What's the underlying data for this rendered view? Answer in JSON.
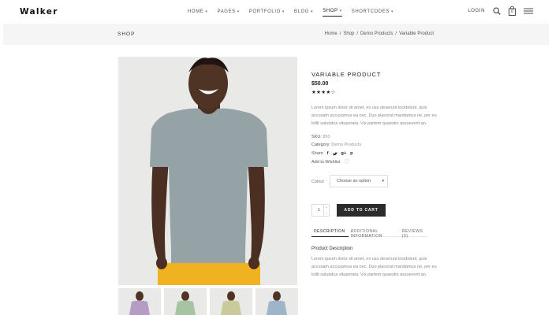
{
  "brand": {
    "logo": "Walker"
  },
  "nav": {
    "items": [
      {
        "label": "HOME",
        "active": false
      },
      {
        "label": "PAGES",
        "active": false
      },
      {
        "label": "PORTFOLIO",
        "active": false
      },
      {
        "label": "BLOG",
        "active": false
      },
      {
        "label": "SHOP",
        "active": true
      },
      {
        "label": "SHORTCODES",
        "active": false
      }
    ],
    "login": "LOGIN",
    "cart_count": "0",
    "icons": [
      "search-icon",
      "bag-icon",
      "menu-icon"
    ]
  },
  "title_band": {
    "title": "SHOP",
    "breadcrumbs": [
      "Home",
      "Shop",
      "Demo Products",
      "Variable Product"
    ],
    "separator": "/"
  },
  "product": {
    "title": "VARIABLE PRODUCT",
    "price": "$50.00",
    "rating": 4,
    "rating_max": 5,
    "short_description": "Lorem ipsum dolor sit amet, ex usu deserunt incididunt, quis accusam accusamus ea nec. Duo placerat mandamus ne, per eu tollit salutatus vituperata. Vix partem quaestio assueverit an.",
    "sku_label": "SKU:",
    "sku_value": "850",
    "category_label": "Category:",
    "category_value": "Demo Products",
    "share_label": "Share",
    "share_icons": [
      "facebook-icon",
      "twitter-icon",
      "google-plus-icon",
      "pinterest-icon"
    ],
    "wishlist_label": "Add to Wishlist",
    "variation_label": "Colour",
    "variation_selected": "Choose an option",
    "quantity": "1",
    "add_to_cart": "ADD TO CART",
    "tabs": [
      {
        "label": "DESCRIPTION",
        "active": true
      },
      {
        "label": "ADDITIONAL INFORMATION",
        "active": false
      },
      {
        "label": "REVIEWS (0)",
        "active": false
      }
    ],
    "description_title": "Product Description",
    "description_text": "Lorem ipsum dolor sit amet, ex usu deserunt incididunt, quis accusam accusamus ea nec. Duo placerat mandamus ne, per eu tollit salutatus vituperata. Vix partem quaestio assueverit an."
  },
  "gallery": {
    "thumb_shirt_colors": [
      "#b49cc4",
      "#a7c4a2",
      "#c9c99c",
      "#9eb4c8"
    ],
    "main_shirt_color": "#95a2a6",
    "main_pants_color": "#f0b221"
  },
  "colors": {
    "accent": "#2b2b2b",
    "band": "#f5f5f5",
    "muted_text": "#888888"
  }
}
